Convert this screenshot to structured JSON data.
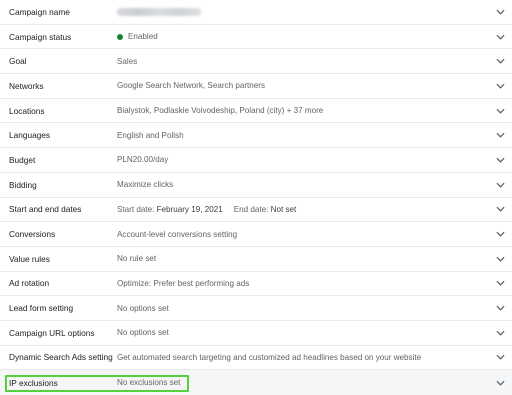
{
  "settings": {
    "rows": [
      {
        "label": "Campaign name",
        "value": ""
      },
      {
        "label": "Campaign status",
        "value": "Enabled"
      },
      {
        "label": "Goal",
        "value": "Sales"
      },
      {
        "label": "Networks",
        "value": "Google Search Network, Search partners"
      },
      {
        "label": "Locations",
        "value": "Bialystok, Podlaskie Voivodeship, Poland (city) + 37 more"
      },
      {
        "label": "Languages",
        "value": "English and Polish"
      },
      {
        "label": "Budget",
        "value": "PLN20.00/day"
      },
      {
        "label": "Bidding",
        "value": "Maximize clicks"
      },
      {
        "label": "Start and end dates",
        "start_prefix": "Start date:",
        "start_value": "February 19, 2021",
        "end_prefix": "End date:",
        "end_value": "Not set"
      },
      {
        "label": "Conversions",
        "value": "Account-level conversions setting"
      },
      {
        "label": "Value rules",
        "value": "No rule set"
      },
      {
        "label": "Ad rotation",
        "value": "Optimize: Prefer best performing ads"
      },
      {
        "label": "Lead form setting",
        "value": "No options set"
      },
      {
        "label": "Campaign URL options",
        "value": "No options set"
      },
      {
        "label": "Dynamic Search Ads setting",
        "value": "Get automated search targeting and customized ad headlines based on your website"
      },
      {
        "label": "IP exclusions",
        "value": "No exclusions set"
      }
    ]
  },
  "icons": {
    "expand": "chevron-down-icon",
    "status": "status-dot-icon"
  },
  "colors": {
    "status_enabled": "#188038",
    "highlight": "#57d13a",
    "divider": "#e8eaed",
    "last_row_bg": "#f5f6f7"
  }
}
